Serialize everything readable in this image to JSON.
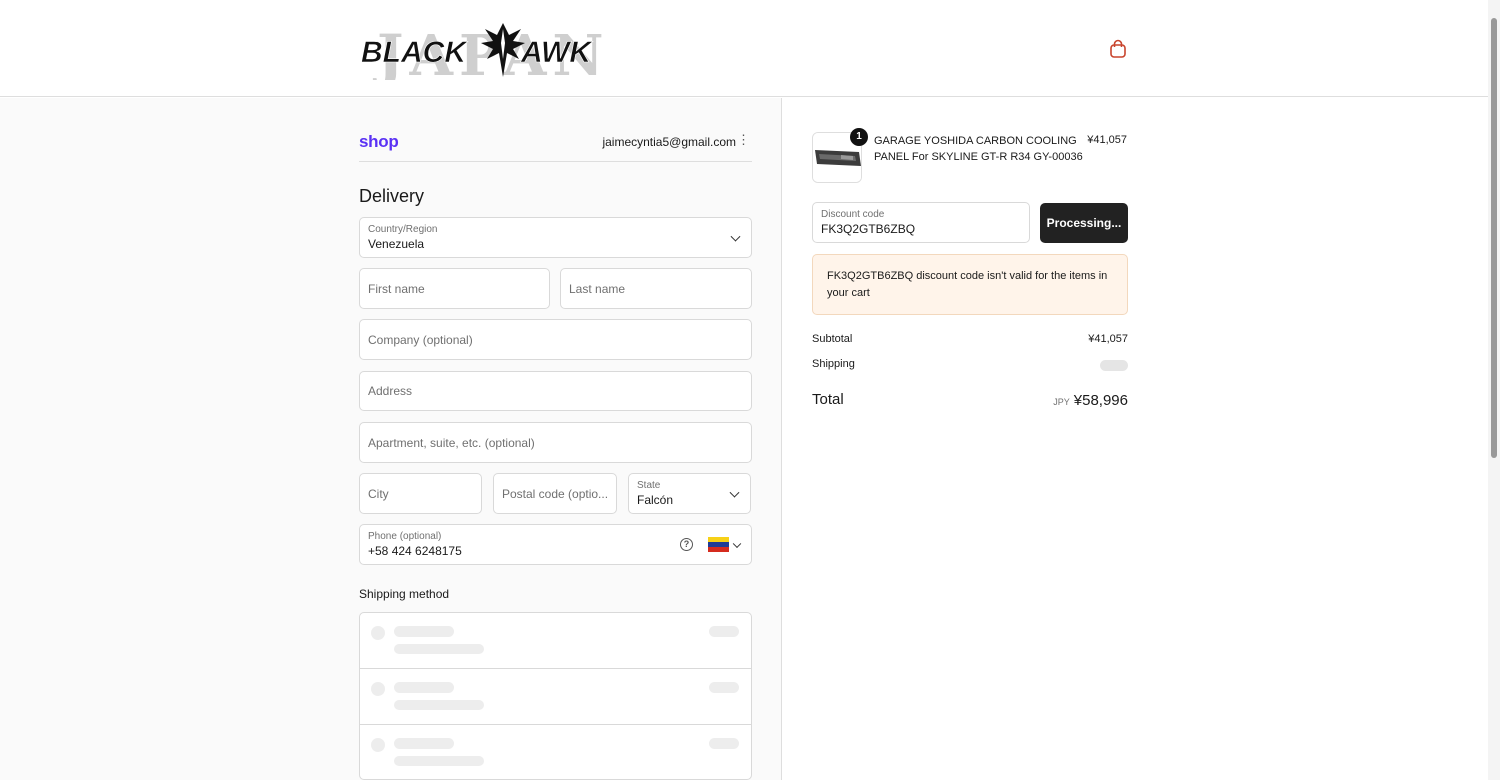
{
  "header": {
    "logo_text": "BLACK AWK",
    "logo_watermark": "JAPAN",
    "cart_icon": "shopping-bag-icon"
  },
  "account": {
    "shop_logo": "shop",
    "email": "jaimecyntia5@gmail.com",
    "menu_glyph": "⋮"
  },
  "delivery": {
    "heading": "Delivery",
    "country": {
      "label": "Country/Region",
      "value": "Venezuela"
    },
    "first_name": {
      "placeholder": "First name"
    },
    "last_name": {
      "placeholder": "Last name"
    },
    "company": {
      "placeholder": "Company (optional)"
    },
    "address": {
      "placeholder": "Address"
    },
    "apartment": {
      "placeholder": "Apartment, suite, etc. (optional)"
    },
    "city": {
      "placeholder": "City"
    },
    "postal": {
      "placeholder": "Postal code (optio..."
    },
    "state": {
      "label": "State",
      "value": "Falcón"
    },
    "phone": {
      "label": "Phone (optional)",
      "value": "+58 424 6248175",
      "help_glyph": "?"
    }
  },
  "shipping_method": {
    "heading": "Shipping method"
  },
  "order": {
    "quantity": "1",
    "item_title": "GARAGE YOSHIDA CARBON COOLING PANEL For SKYLINE GT-R R34 GY-00036",
    "item_price": "¥41,057",
    "discount": {
      "label": "Discount code",
      "value": "FK3Q2GTB6ZBQ",
      "button": "Processing..."
    },
    "alert": "FK3Q2GTB6ZBQ discount code isn't valid for the items in your cart",
    "subtotal_label": "Subtotal",
    "subtotal_value": "¥41,057",
    "shipping_label": "Shipping",
    "total_label": "Total",
    "currency": "JPY",
    "total_value": "¥58,996"
  },
  "colors": {
    "shop_brand": "#5a31f4",
    "cart_icon": "#c8442d",
    "alert_bg": "#fff4ea",
    "button_bg": "#222222"
  }
}
